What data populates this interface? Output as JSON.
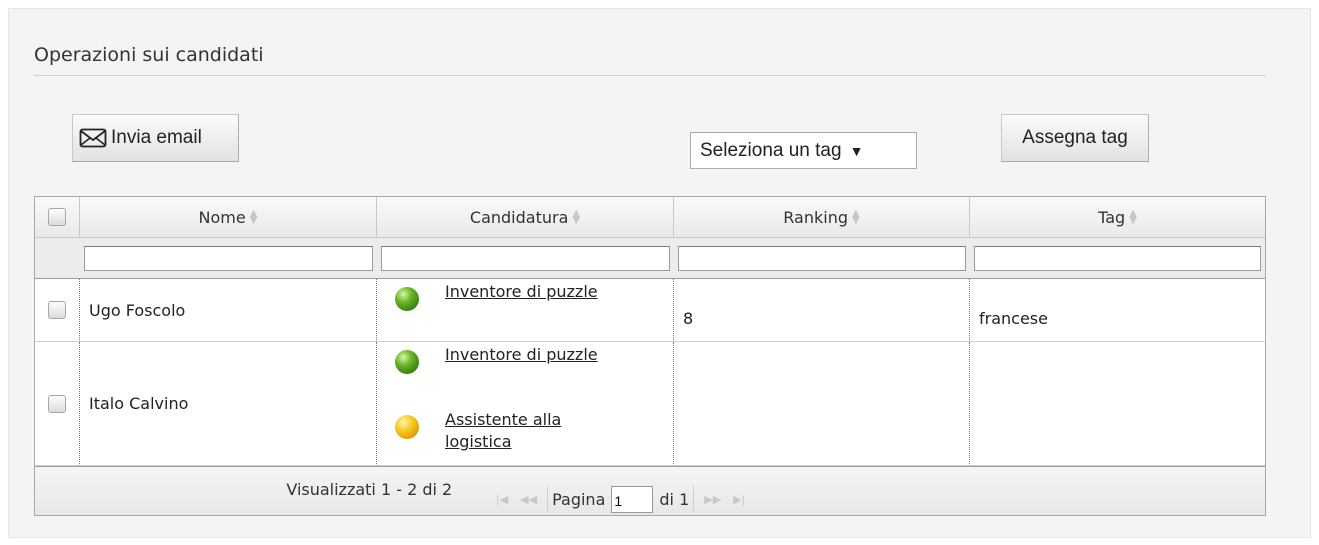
{
  "section": {
    "title": "Operazioni sui candidati"
  },
  "toolbar": {
    "email_label": "Invia email",
    "email_icon": "envelope-icon",
    "tag_select": {
      "selected": "Seleziona un tag",
      "caret": "▼"
    },
    "assign_label": "Assegna tag"
  },
  "table": {
    "columns": [
      "Nome",
      "Candidatura",
      "Ranking",
      "Tag"
    ],
    "rows": [
      {
        "name": "Ugo Foscolo",
        "applications": [
          {
            "status": "green",
            "label": "Inventore di puzzle"
          }
        ],
        "ranking": "8",
        "tag": "francese"
      },
      {
        "name": "Italo Calvino",
        "applications": [
          {
            "status": "green",
            "label": "Inventore di puzzle"
          },
          {
            "status": "yellow",
            "label_line1": "Assistente alla",
            "label_line2": "logistica"
          }
        ],
        "ranking": "",
        "tag": ""
      }
    ],
    "pager": {
      "page_label": "Pagina",
      "page_value": "1",
      "of_label": "di 1"
    },
    "view_info": "Visualizzati 1 - 2 di 2"
  },
  "colors": {
    "status_green": "#6db52a",
    "status_yellow": "#f7c81c"
  }
}
